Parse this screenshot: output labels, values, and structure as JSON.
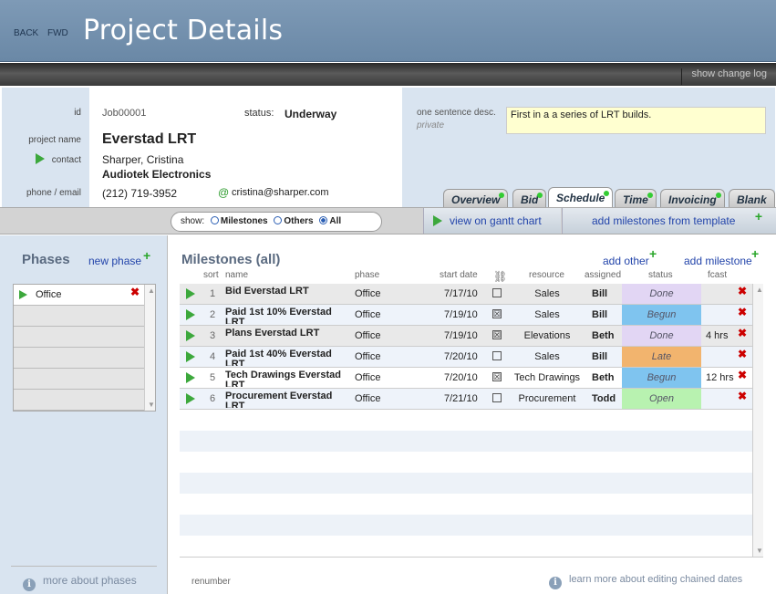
{
  "nav": {
    "back": "BACK",
    "fwd": "FWD"
  },
  "title": "Project Details",
  "change_log": "show change log",
  "labels": {
    "id": "id",
    "project_name": "project name",
    "contact": "contact",
    "phone_email": "phone / email",
    "status": "status:",
    "desc": "one sentence desc.",
    "private": "private"
  },
  "project": {
    "id": "Job00001",
    "status": "Underway",
    "name": "Everstad LRT",
    "contact_name": "Sharper, Cristina",
    "company": "Audiotek Electronics",
    "phone": "(212) 719-3952",
    "email": "cristina@sharper.com",
    "description": "First in a a series of LRT builds."
  },
  "tabs": [
    "Overview",
    "Bid",
    "Schedule",
    "Time",
    "Invoicing",
    "Blank"
  ],
  "show": {
    "label": "show:",
    "options": [
      "Milestones",
      "Others",
      "All"
    ],
    "selected": "All"
  },
  "gantt": "view on gantt chart",
  "template": "add milestones from template",
  "phases": {
    "title": "Phases",
    "new": "new phase",
    "items": [
      "Office"
    ],
    "more": "more about phases"
  },
  "milestones": {
    "title": "Milestones (all)",
    "add_other": "add other",
    "add_milestone": "add milestone",
    "columns": {
      "sort": "sort",
      "name": "name",
      "phase": "phase",
      "start": "start date",
      "resource": "resource",
      "assigned": "assigned",
      "status": "status",
      "fcast": "fcast"
    },
    "rows": [
      {
        "sort": "1",
        "name": "Bid Everstad LRT",
        "phase": "Office",
        "date": "7/17/10",
        "chained": "",
        "resource": "Sales",
        "assigned": "Bill",
        "status": "Done",
        "fcast": ""
      },
      {
        "sort": "2",
        "name": "Paid 1st 10% Everstad LRT",
        "phase": "Office",
        "date": "7/19/10",
        "chained": "☒",
        "resource": "Sales",
        "assigned": "Bill",
        "status": "Begun",
        "fcast": ""
      },
      {
        "sort": "3",
        "name": "Plans Everstad LRT",
        "phase": "Office",
        "date": "7/19/10",
        "chained": "☒",
        "resource": "Elevations",
        "assigned": "Beth",
        "status": "Done",
        "fcast": "4 hrs"
      },
      {
        "sort": "4",
        "name": "Paid 1st 40% Everstad LRT",
        "phase": "Office",
        "date": "7/20/10",
        "chained": "",
        "resource": "Sales",
        "assigned": "Bill",
        "status": "Late",
        "fcast": ""
      },
      {
        "sort": "5",
        "name": "Tech Drawings Everstad LRT",
        "phase": "Office",
        "date": "7/20/10",
        "chained": "☒",
        "resource": "Tech Drawings",
        "assigned": "Beth",
        "status": "Begun",
        "fcast": "12 hrs"
      },
      {
        "sort": "6",
        "name": "Procurement Everstad LRT",
        "phase": "Office",
        "date": "7/21/10",
        "chained": "",
        "resource": "Procurement",
        "assigned": "Todd",
        "status": "Open",
        "fcast": ""
      }
    ],
    "renumber": "renumber",
    "learn": "learn more about editing chained dates"
  },
  "colors": {
    "Done": "#e2d6f4",
    "Begun": "#7fc4ef",
    "Late": "#f2b46e",
    "Open": "#b8f2b0"
  }
}
